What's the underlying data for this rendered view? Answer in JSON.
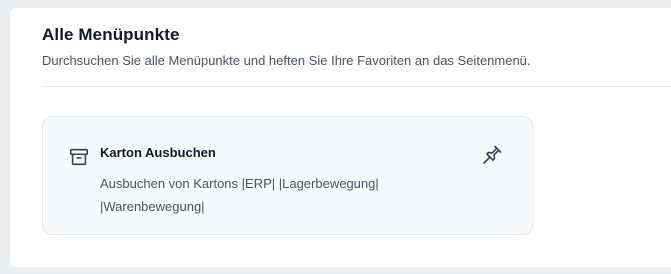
{
  "header": {
    "title": "Alle Menüpunkte",
    "subtitle": "Durchsuchen Sie alle Menüpunkte und heften Sie Ihre Favoriten an das Seitenmenü."
  },
  "menu_items": [
    {
      "title": "Karton Ausbuchen",
      "description": "Ausbuchen von Kartons |ERP| |Lagerbewegung| |Warenbewegung|",
      "icon": "archive-box-icon",
      "pin_icon": "pin-icon"
    }
  ]
}
